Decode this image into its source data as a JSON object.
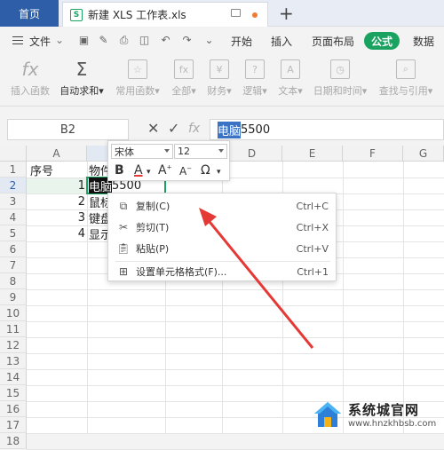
{
  "tabs": {
    "home": "首页",
    "file": "新建 XLS 工作表.xls",
    "new_tab": "+"
  },
  "menubar": {
    "file": "文件",
    "items": [
      "开始",
      "插入",
      "页面布局",
      "公式",
      "数据"
    ],
    "active": "公式"
  },
  "ribbon": {
    "items": [
      "插入函数",
      "自动求和",
      "常用函数",
      "全部",
      "财务",
      "逻辑",
      "文本",
      "日期和时间",
      "查找与引用"
    ]
  },
  "formula_bar": {
    "name_box": "B2",
    "fx": "fx",
    "value_highlight": "电脑",
    "value_rest": "5500"
  },
  "grid": {
    "columns": [
      "A",
      "B",
      "C",
      "D",
      "E",
      "F",
      "G"
    ],
    "rows": [
      "1",
      "2",
      "3",
      "4",
      "5",
      "6",
      "7",
      "8",
      "9",
      "10",
      "11",
      "12",
      "13",
      "14",
      "15",
      "16",
      "17",
      "18"
    ],
    "cells": {
      "a1": "序号",
      "b1": "物件",
      "a2": "1",
      "b2_highlight": "电脑",
      "b2_rest": "5500",
      "a3": "2",
      "b3": "鼠标",
      "a4": "3",
      "b4": "键盘",
      "a5": "4",
      "b5": "显示"
    }
  },
  "mini_toolbar": {
    "font": "宋体",
    "size": "12",
    "bold": "B",
    "font_color": "A",
    "grow": "A",
    "shrink": "A",
    "symbol": "Ω"
  },
  "context_menu": [
    {
      "label": "复制(C)",
      "shortcut": "Ctrl+C",
      "icon": "copy-icon"
    },
    {
      "label": "剪切(T)",
      "shortcut": "Ctrl+X",
      "icon": "scissors-icon"
    },
    {
      "label": "粘贴(P)",
      "shortcut": "Ctrl+V",
      "icon": "paste-icon"
    },
    {
      "label": "设置单元格格式(F)...",
      "shortcut": "Ctrl+1",
      "icon": "format-cells-icon"
    }
  ],
  "watermark": {
    "title": "系统城官网",
    "url": "www.hnzkhbsb.com"
  },
  "colors": {
    "accent_green": "#1aa260",
    "home_tab": "#2e5ea8",
    "arrow": "#e53935",
    "selection": "#3a72c4"
  }
}
